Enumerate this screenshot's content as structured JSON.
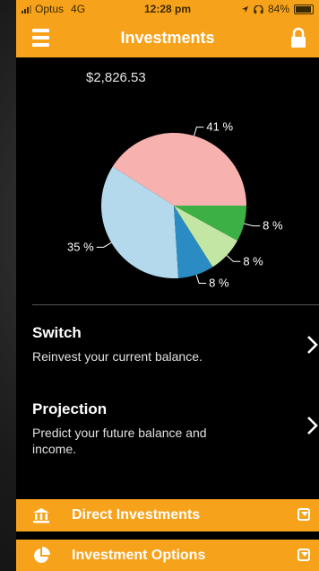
{
  "status_bar": {
    "carrier": "Optus",
    "network": "4G",
    "time": "12:28 pm",
    "battery": "84%"
  },
  "nav": {
    "title": "Investments"
  },
  "balance": "$2,826.53",
  "chart_data": {
    "type": "pie",
    "slices": [
      {
        "label": "41 %",
        "value": 41,
        "color": "#f7b2b0"
      },
      {
        "label": "35 %",
        "value": 35,
        "color": "#b5d9ec"
      },
      {
        "label": "8 %",
        "value": 8,
        "color": "#2a8cc2"
      },
      {
        "label": "8 %",
        "value": 8,
        "color": "#c4e6a4"
      },
      {
        "label": "8 %",
        "value": 8,
        "color": "#3cb044"
      }
    ]
  },
  "menu": [
    {
      "title": "Switch",
      "subtitle": "Reinvest your current balance."
    },
    {
      "title": "Projection",
      "subtitle": "Predict your future balance and income."
    }
  ],
  "bars": [
    {
      "label": "Direct Investments",
      "icon": "bank-icon"
    },
    {
      "label": "Investment Options",
      "icon": "pie-chart-icon"
    }
  ],
  "colors": {
    "accent": "#f7a21b",
    "background": "#000000"
  }
}
